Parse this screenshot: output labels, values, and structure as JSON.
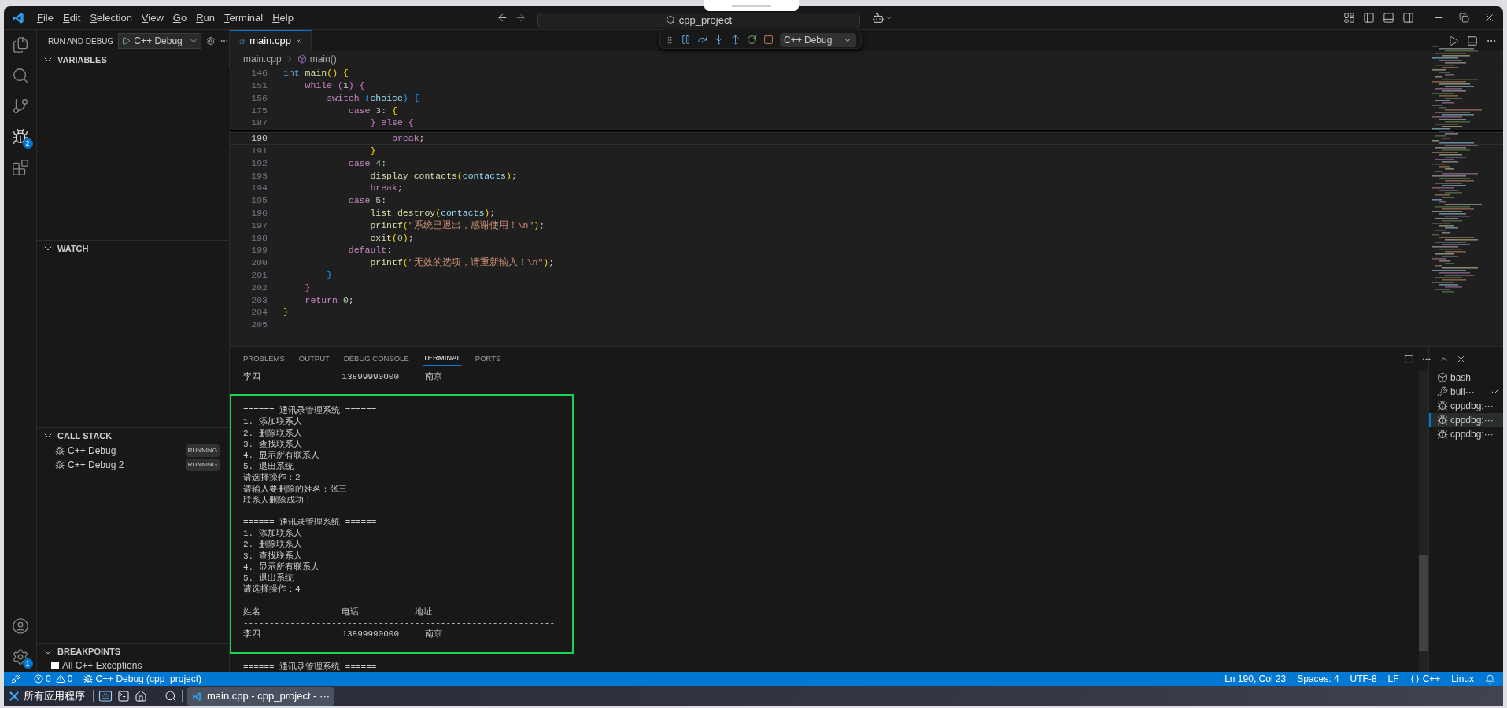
{
  "menu": [
    {
      "label": "File"
    },
    {
      "label": "Edit"
    },
    {
      "label": "Selection"
    },
    {
      "label": "View"
    },
    {
      "label": "Go"
    },
    {
      "label": "Run"
    },
    {
      "label": "Terminal"
    },
    {
      "label": "Help"
    }
  ],
  "search": {
    "value": "cpp_project"
  },
  "activity": {
    "debug_badge": "2",
    "settings_badge": "1"
  },
  "sidebar": {
    "title": "RUN AND DEBUG",
    "config": "C++ Debug",
    "variables": {
      "title": "VARIABLES",
      "expanded": true
    },
    "watch": {
      "title": "WATCH",
      "expanded": true
    },
    "call_stack": {
      "title": "CALL STACK",
      "expanded": true,
      "items": [
        {
          "label": "C++ Debug",
          "status": "RUNNING"
        },
        {
          "label": "C++ Debug 2",
          "status": "RUNNING"
        }
      ]
    },
    "breakpoints": {
      "title": "BREAKPOINTS",
      "expanded": true,
      "items": [
        {
          "label": "All C++ Exceptions",
          "checked": false
        }
      ]
    }
  },
  "editor": {
    "tabs": [
      {
        "label": "main.cpp",
        "selected": true
      }
    ],
    "breadcrumb": [
      "main.cpp",
      "main()"
    ],
    "sticky_lines": [
      {
        "number": "146",
        "tokens": [
          {
            "text": "int",
            "kind": "type"
          },
          {
            "text": " main",
            "kind": "function"
          },
          {
            "text": "()",
            "kind": "bracket1"
          },
          {
            "text": " {",
            "kind": "bracket1"
          }
        ]
      },
      {
        "number": "151",
        "tokens": [
          {
            "text": "    while",
            "kind": "keyword"
          },
          {
            "text": " (",
            "kind": "bracket2"
          },
          {
            "text": "1",
            "kind": "number"
          },
          {
            "text": ")",
            "kind": "bracket2"
          },
          {
            "text": " {",
            "kind": "bracket2"
          }
        ]
      },
      {
        "number": "156",
        "tokens": [
          {
            "text": "        switch",
            "kind": "keyword"
          },
          {
            "text": " (",
            "kind": "bracket3"
          },
          {
            "text": "choice",
            "kind": "variable"
          },
          {
            "text": ")",
            "kind": "bracket3"
          },
          {
            "text": " {",
            "kind": "bracket3"
          }
        ]
      },
      {
        "number": "175",
        "tokens": [
          {
            "text": "            case",
            "kind": "keyword"
          },
          {
            "text": " 3",
            "kind": "number"
          },
          {
            "text": ":",
            "kind": "punct"
          },
          {
            "text": " {",
            "kind": "bracket1"
          }
        ]
      },
      {
        "number": "187",
        "tokens": [
          {
            "text": "                }",
            "kind": "bracket2"
          },
          {
            "text": " else",
            "kind": "keyword"
          },
          {
            "text": " {",
            "kind": "bracket2"
          }
        ]
      }
    ],
    "lines": [
      {
        "number": "190",
        "current": true,
        "tokens": [
          {
            "text": "                    break",
            "kind": "keyword"
          },
          {
            "text": ";",
            "kind": "punct"
          }
        ]
      },
      {
        "number": "191",
        "current": false,
        "tokens": [
          {
            "text": "                }",
            "kind": "bracket1"
          }
        ]
      },
      {
        "number": "192",
        "current": false,
        "tokens": [
          {
            "text": "            case",
            "kind": "keyword"
          },
          {
            "text": " 4",
            "kind": "number"
          },
          {
            "text": ":",
            "kind": "punct"
          }
        ]
      },
      {
        "number": "193",
        "current": false,
        "tokens": [
          {
            "text": "                display_contacts",
            "kind": "function"
          },
          {
            "text": "(",
            "kind": "bracket1"
          },
          {
            "text": "contacts",
            "kind": "variable"
          },
          {
            "text": ")",
            "kind": "bracket1"
          },
          {
            "text": ";",
            "kind": "punct"
          }
        ]
      },
      {
        "number": "194",
        "current": false,
        "tokens": [
          {
            "text": "                break",
            "kind": "keyword"
          },
          {
            "text": ";",
            "kind": "punct"
          }
        ]
      },
      {
        "number": "195",
        "current": false,
        "tokens": [
          {
            "text": "            case",
            "kind": "keyword"
          },
          {
            "text": " 5",
            "kind": "number"
          },
          {
            "text": ":",
            "kind": "punct"
          }
        ]
      },
      {
        "number": "196",
        "current": false,
        "tokens": [
          {
            "text": "                list_destroy",
            "kind": "function"
          },
          {
            "text": "(",
            "kind": "bracket1"
          },
          {
            "text": "contacts",
            "kind": "variable"
          },
          {
            "text": ")",
            "kind": "bracket1"
          },
          {
            "text": ";",
            "kind": "punct"
          }
        ]
      },
      {
        "number": "197",
        "current": false,
        "tokens": [
          {
            "text": "                printf",
            "kind": "function"
          },
          {
            "text": "(",
            "kind": "bracket1"
          },
          {
            "text": "\"系统已退出，感谢使用！\\n\"",
            "kind": "string"
          },
          {
            "text": ")",
            "kind": "bracket1"
          },
          {
            "text": ";",
            "kind": "punct"
          }
        ]
      },
      {
        "number": "198",
        "current": false,
        "tokens": [
          {
            "text": "                exit",
            "kind": "function"
          },
          {
            "text": "(",
            "kind": "bracket1"
          },
          {
            "text": "0",
            "kind": "number"
          },
          {
            "text": ")",
            "kind": "bracket1"
          },
          {
            "text": ";",
            "kind": "punct"
          }
        ]
      },
      {
        "number": "199",
        "current": false,
        "tokens": [
          {
            "text": "            default",
            "kind": "keyword"
          },
          {
            "text": ":",
            "kind": "punct"
          }
        ]
      },
      {
        "number": "200",
        "current": false,
        "tokens": [
          {
            "text": "                printf",
            "kind": "function"
          },
          {
            "text": "(",
            "kind": "bracket1"
          },
          {
            "text": "\"无效的选项，请重新输入！\\n\"",
            "kind": "string"
          },
          {
            "text": ")",
            "kind": "bracket1"
          },
          {
            "text": ";",
            "kind": "punct"
          }
        ]
      },
      {
        "number": "201",
        "current": false,
        "tokens": [
          {
            "text": "        }",
            "kind": "bracket3"
          }
        ]
      },
      {
        "number": "202",
        "current": false,
        "tokens": [
          {
            "text": "    }",
            "kind": "bracket2"
          }
        ]
      },
      {
        "number": "203",
        "current": false,
        "tokens": [
          {
            "text": "    return",
            "kind": "keyword"
          },
          {
            "text": " 0",
            "kind": "number"
          },
          {
            "text": ";",
            "kind": "punct"
          }
        ]
      },
      {
        "number": "204",
        "current": false,
        "tokens": [
          {
            "text": "}",
            "kind": "bracket1"
          }
        ]
      },
      {
        "number": "205",
        "current": false
      }
    ]
  },
  "debug_toolbar": {
    "config": "C++ Debug"
  },
  "panel": {
    "tabs": [
      {
        "label": "PROBLEMS",
        "selected": false
      },
      {
        "label": "OUTPUT",
        "selected": false
      },
      {
        "label": "DEBUG CONSOLE",
        "selected": false
      },
      {
        "label": "TERMINAL",
        "selected": true
      },
      {
        "label": "PORTS",
        "selected": false
      }
    ],
    "terminal": {
      "before": [
        {
          "kind": "row",
          "cells": [
            "李四",
            "13899990000",
            "南京"
          ]
        }
      ],
      "boxed": [
        {
          "kind": "text",
          "text": "====== 通讯录管理系统 ======"
        },
        {
          "kind": "text",
          "text": "1. 添加联系人"
        },
        {
          "kind": "text",
          "text": "2. 删除联系人"
        },
        {
          "kind": "text",
          "text": "3. 查找联系人"
        },
        {
          "kind": "text",
          "text": "4. 显示所有联系人"
        },
        {
          "kind": "text",
          "text": "5. 退出系统"
        },
        {
          "kind": "text",
          "text": "请选择操作：2"
        },
        {
          "kind": "text",
          "text": "请输入要删除的姓名：张三"
        },
        {
          "kind": "text",
          "text": "联系人删除成功！"
        },
        {
          "kind": "blank"
        },
        {
          "kind": "text",
          "text": "====== 通讯录管理系统 ======"
        },
        {
          "kind": "text",
          "text": "1. 添加联系人"
        },
        {
          "kind": "text",
          "text": "2. 删除联系人"
        },
        {
          "kind": "text",
          "text": "3. 查找联系人"
        },
        {
          "kind": "text",
          "text": "4. 显示所有联系人"
        },
        {
          "kind": "text",
          "text": "5. 退出系统"
        },
        {
          "kind": "text",
          "text": "请选择操作：4"
        },
        {
          "kind": "blank"
        },
        {
          "kind": "header",
          "cells": [
            "姓名",
            "电话",
            "地址"
          ]
        },
        {
          "kind": "text",
          "text": "------------------------------------------------------------"
        },
        {
          "kind": "row",
          "cells": [
            "李四",
            "13899990000",
            "南京"
          ]
        }
      ],
      "after": [
        {
          "kind": "text",
          "text": "====== 通讯录管理系统 ======"
        }
      ]
    },
    "terminals": [
      {
        "label": "bash",
        "kind": "shell",
        "selected": false,
        "succeeded": false
      },
      {
        "label": "buil···",
        "kind": "task",
        "selected": false,
        "succeeded": true
      },
      {
        "label": "cppdbg:···",
        "kind": "debug",
        "selected": false,
        "succeeded": false
      },
      {
        "label": "cppdbg:···",
        "kind": "debug",
        "selected": true,
        "succeeded": false
      },
      {
        "label": "cppdbg:···",
        "kind": "debug",
        "selected": false,
        "succeeded": false
      }
    ]
  },
  "status_bar": {
    "errors": "0",
    "warnings": "0",
    "debug": "C++ Debug (cpp_project)",
    "position": "Ln 190, Col 23",
    "spaces": "Spaces: 4",
    "encoding": "UTF-8",
    "eol": "LF",
    "language": "C++",
    "os": "Linux"
  },
  "taskbar": {
    "start": "所有应用程序",
    "window": "main.cpp - cpp_project - ···"
  }
}
